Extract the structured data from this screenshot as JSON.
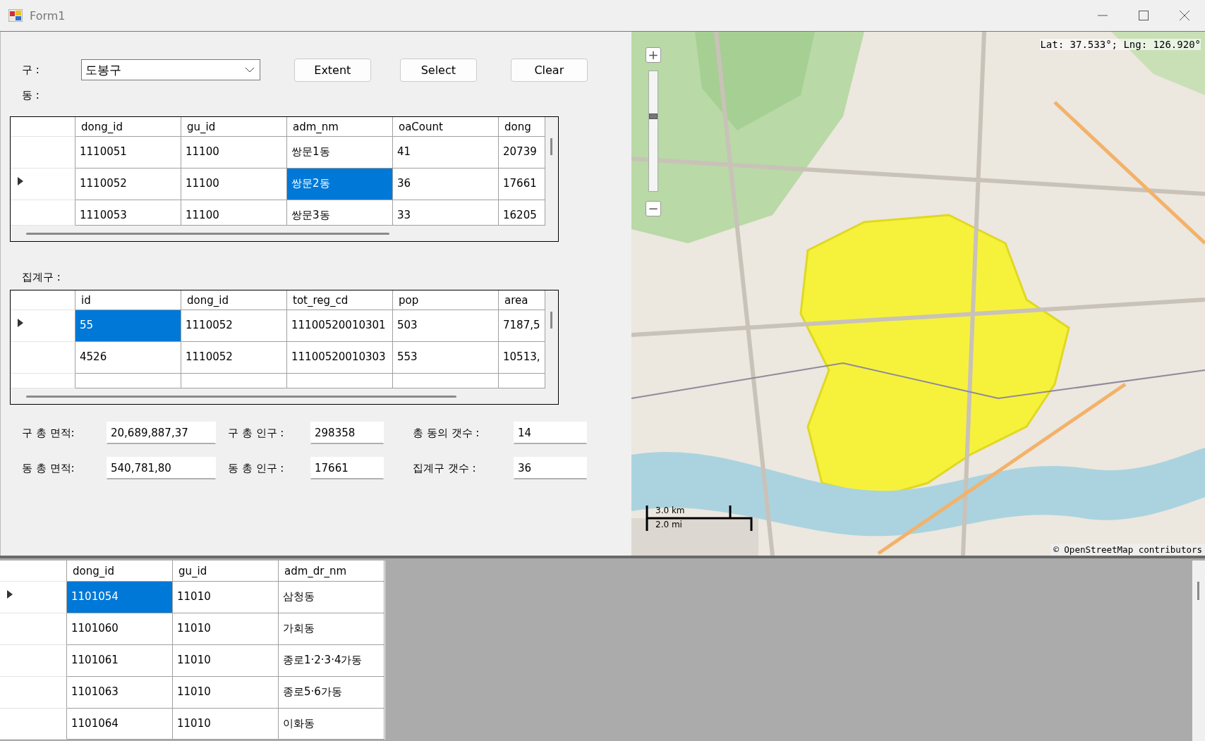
{
  "window": {
    "title": "Form1"
  },
  "gu_label": "구 :",
  "gu_combo": {
    "value": "도봉구"
  },
  "buttons": [
    "Extent",
    "Select",
    "Clear"
  ],
  "dong_label": "동 :",
  "dong_grid": {
    "columns": [
      "dong_id",
      "gu_id",
      "adm_nm",
      "oaCount",
      "dong"
    ],
    "rows": [
      {
        "current": false,
        "cells": [
          {
            "text": "1110051",
            "selected": false
          },
          {
            "text": "11100",
            "selected": false
          },
          {
            "text": "쌍문1동",
            "selected": false
          },
          {
            "text": "41",
            "selected": false
          },
          {
            "text": "20739",
            "selected": false
          }
        ]
      },
      {
        "current": true,
        "cells": [
          {
            "text": "1110052",
            "selected": false
          },
          {
            "text": "11100",
            "selected": false
          },
          {
            "text": "쌍문2동",
            "selected": true
          },
          {
            "text": "36",
            "selected": false
          },
          {
            "text": "17661",
            "selected": false
          }
        ]
      },
      {
        "current": false,
        "cells": [
          {
            "text": "1110053",
            "selected": false
          },
          {
            "text": "11100",
            "selected": false
          },
          {
            "text": "쌍문3동",
            "selected": false
          },
          {
            "text": "33",
            "selected": false
          },
          {
            "text": "16205",
            "selected": false
          }
        ]
      }
    ]
  },
  "tract_label": "집계구 :",
  "tract_grid": {
    "columns": [
      "id",
      "dong_id",
      "tot_reg_cd",
      "pop",
      "area"
    ],
    "rows": [
      {
        "current": true,
        "cells": [
          {
            "text": "55",
            "selected": true
          },
          {
            "text": "1110052",
            "selected": false
          },
          {
            "text": "11100520010301",
            "selected": false
          },
          {
            "text": "503",
            "selected": false
          },
          {
            "text": "7187,5",
            "selected": false
          }
        ]
      },
      {
        "current": false,
        "cells": [
          {
            "text": "4526",
            "selected": false
          },
          {
            "text": "1110052",
            "selected": false
          },
          {
            "text": "11100520010303",
            "selected": false
          },
          {
            "text": "553",
            "selected": false
          },
          {
            "text": "10513,",
            "selected": false
          }
        ]
      }
    ]
  },
  "stats": [
    {
      "label": "구 총 면적:",
      "value": "20,689,887,37"
    },
    {
      "label": "구 총 인구 :",
      "value": "298358"
    },
    {
      "label": "총 동의 갯수 :",
      "value": "14"
    },
    {
      "label": "동 총 면적:",
      "value": "540,781,80"
    },
    {
      "label": "동 총 인구 :",
      "value": "17661"
    },
    {
      "label": "집계구 갯수 :",
      "value": "36"
    }
  ],
  "map": {
    "kind": "picture",
    "zoom_slider": {
      "level": 0.63
    },
    "zoom_in": "+",
    "zoom_out": "−",
    "coordinates": "Lat: 37.533°; Lng: 126.920°",
    "scale_km": "3.0 km",
    "scale_mi": "2.0 mi",
    "attribution": "© OpenStreetMap contributors"
  },
  "bottom_grid": {
    "columns": [
      "dong_id",
      "gu_id",
      "adm_dr_nm"
    ],
    "rows": [
      {
        "current": true,
        "cells": [
          {
            "text": "1101054",
            "selected": true
          },
          {
            "text": "11010",
            "selected": false
          },
          {
            "text": "삼청동",
            "selected": false
          }
        ]
      },
      {
        "current": false,
        "cells": [
          {
            "text": "1101060",
            "selected": false
          },
          {
            "text": "11010",
            "selected": false
          },
          {
            "text": "가회동",
            "selected": false
          }
        ]
      },
      {
        "current": false,
        "cells": [
          {
            "text": "1101061",
            "selected": false
          },
          {
            "text": "11010",
            "selected": false
          },
          {
            "text": "종로1·2·3·4가동",
            "selected": false
          }
        ]
      },
      {
        "current": false,
        "cells": [
          {
            "text": "1101063",
            "selected": false
          },
          {
            "text": "11010",
            "selected": false
          },
          {
            "text": "종로5·6가동",
            "selected": false
          }
        ]
      },
      {
        "current": false,
        "cells": [
          {
            "text": "1101064",
            "selected": false
          },
          {
            "text": "11010",
            "selected": false
          },
          {
            "text": "이화동",
            "selected": false
          }
        ]
      }
    ]
  }
}
